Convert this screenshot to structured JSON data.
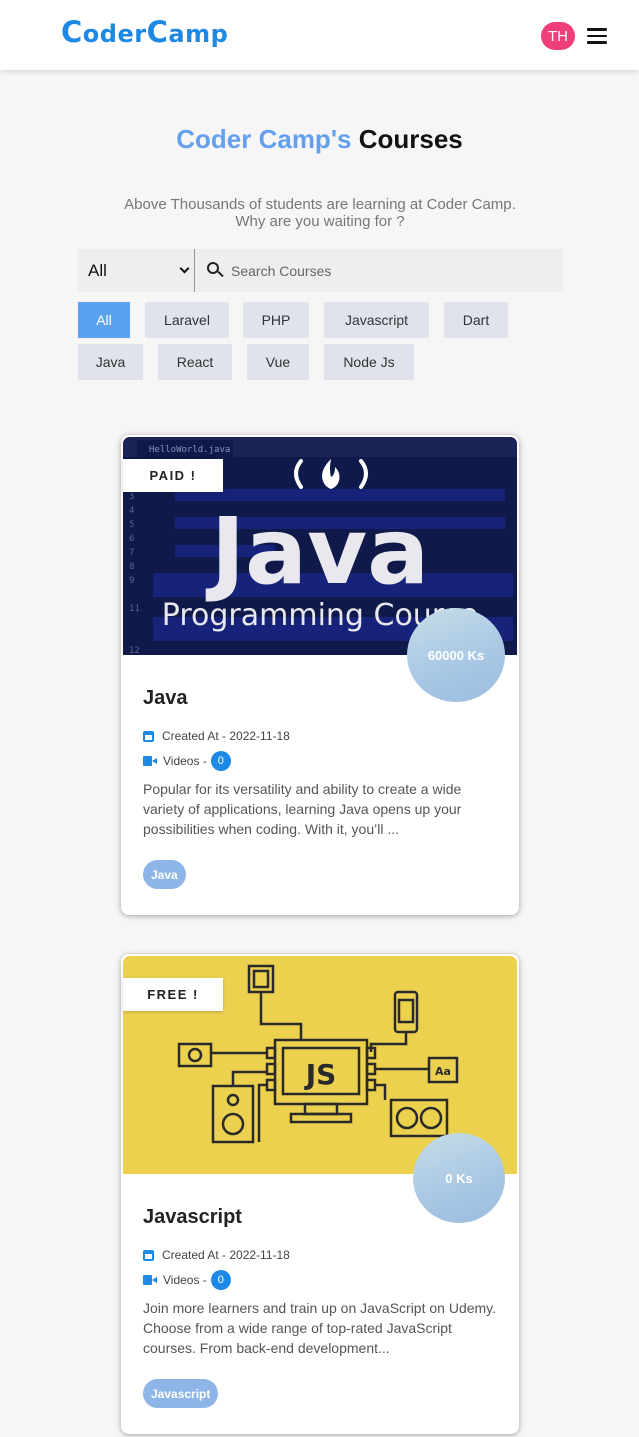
{
  "header": {
    "logo_part1": "C",
    "logo_part2": "oder",
    "logo_part3": "C",
    "logo_part4": "amp",
    "avatar_initials": "TH",
    "menu_icon": "hamburger-menu-icon"
  },
  "hero": {
    "title_accent": "Coder Camp's",
    "title_rest": "Courses",
    "subtitle_line1": "Above Thousands of students are learning at Coder Camp.",
    "subtitle_line2": "Why are you waiting for ?"
  },
  "search": {
    "category_selected": "All",
    "placeholder": "Search Courses",
    "icon": "search-icon"
  },
  "tags": [
    {
      "label": "All",
      "active": true
    },
    {
      "label": "Laravel",
      "active": false
    },
    {
      "label": "PHP",
      "active": false
    },
    {
      "label": "Javascript",
      "active": false
    },
    {
      "label": "Dart",
      "active": false
    },
    {
      "label": "Java",
      "active": false
    },
    {
      "label": "React",
      "active": false
    },
    {
      "label": "Vue",
      "active": false
    },
    {
      "label": "Node Js",
      "active": false
    }
  ],
  "courses": [
    {
      "status": "PAID !",
      "price": "60000 Ks",
      "title": "Java",
      "created_label": "Created At - 2022-11-18",
      "videos_label": "Videos -",
      "videos_count": "0",
      "description": "Popular for its versatility and ability to create a wide variety of applications, learning Java opens up your possibilities when coding. With it, you’ll ...",
      "tag": "Java",
      "image": {
        "tab_name": "HelloWorld.java",
        "headline": "Java",
        "subheadline": "Programming Course",
        "bg_color": "#0f1a4a"
      }
    },
    {
      "status": "FREE !",
      "price": "0 Ks",
      "title": "Javascript",
      "created_label": "Created At - 2022-11-18",
      "videos_label": "Videos -",
      "videos_count": "0",
      "description": "Join more learners and train up on JavaScript on Udemy. Choose from a wide range of top-rated JavaScript courses. From back-end development...",
      "tag": "Javascript",
      "image": {
        "monitor_text": "JS",
        "speaker_text": "Aa",
        "bg_color": "#ecd14f"
      }
    }
  ],
  "colors": {
    "brand": "#1e88e5",
    "accent_title": "#64a0f0",
    "avatar": "#ee3f78",
    "active_tag": "#5aa1f0",
    "chip": "#8db5e7"
  }
}
